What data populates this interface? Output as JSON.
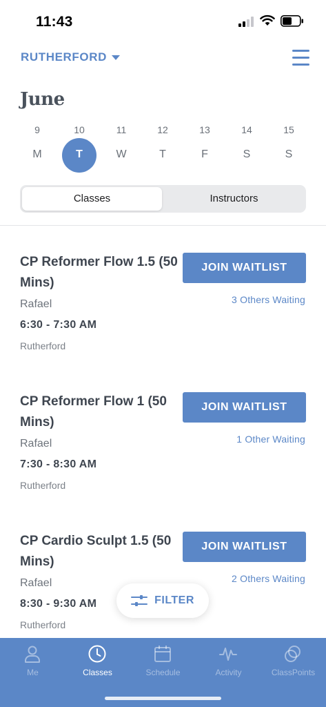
{
  "status_bar": {
    "time": "11:43"
  },
  "header": {
    "location": "RUTHERFORD",
    "month": "June"
  },
  "week": [
    {
      "num": "9",
      "letter": "M",
      "selected": false
    },
    {
      "num": "10",
      "letter": "T",
      "selected": true
    },
    {
      "num": "11",
      "letter": "W",
      "selected": false
    },
    {
      "num": "12",
      "letter": "T",
      "selected": false
    },
    {
      "num": "13",
      "letter": "F",
      "selected": false
    },
    {
      "num": "14",
      "letter": "S",
      "selected": false
    },
    {
      "num": "15",
      "letter": "S",
      "selected": false
    }
  ],
  "segments": {
    "classes": "Classes",
    "instructors": "Instructors",
    "active": "classes"
  },
  "classes": [
    {
      "title": "CP Reformer Flow 1.5 (50 Mins)",
      "instructor": "Rafael",
      "time": "6:30 - 7:30 AM",
      "location": "Rutherford",
      "button": "JOIN WAITLIST",
      "waiting": "3 Others Waiting"
    },
    {
      "title": "CP Reformer Flow 1 (50 Mins)",
      "instructor": "Rafael",
      "time": "7:30 - 8:30 AM",
      "location": "Rutherford",
      "button": "JOIN WAITLIST",
      "waiting": "1 Other Waiting"
    },
    {
      "title": "CP Cardio Sculpt 1.5 (50 Mins)",
      "instructor": "Rafael",
      "time": "8:30 - 9:30 AM",
      "location": "Rutherford",
      "button": "JOIN WAITLIST",
      "waiting": "2 Others Waiting"
    }
  ],
  "filter": {
    "label": "FILTER"
  },
  "tabs": [
    {
      "label": "Me",
      "icon": "person-icon",
      "active": false
    },
    {
      "label": "Classes",
      "icon": "clock-icon",
      "active": true
    },
    {
      "label": "Schedule",
      "icon": "calendar-icon",
      "active": false
    },
    {
      "label": "Activity",
      "icon": "activity-icon",
      "active": false
    },
    {
      "label": "ClassPoints",
      "icon": "classpoints-icon",
      "active": false
    }
  ],
  "colors": {
    "accent": "#5b87c7",
    "text": "#3f4650",
    "muted": "#7b8088",
    "segment_bg": "#e9eaec"
  }
}
